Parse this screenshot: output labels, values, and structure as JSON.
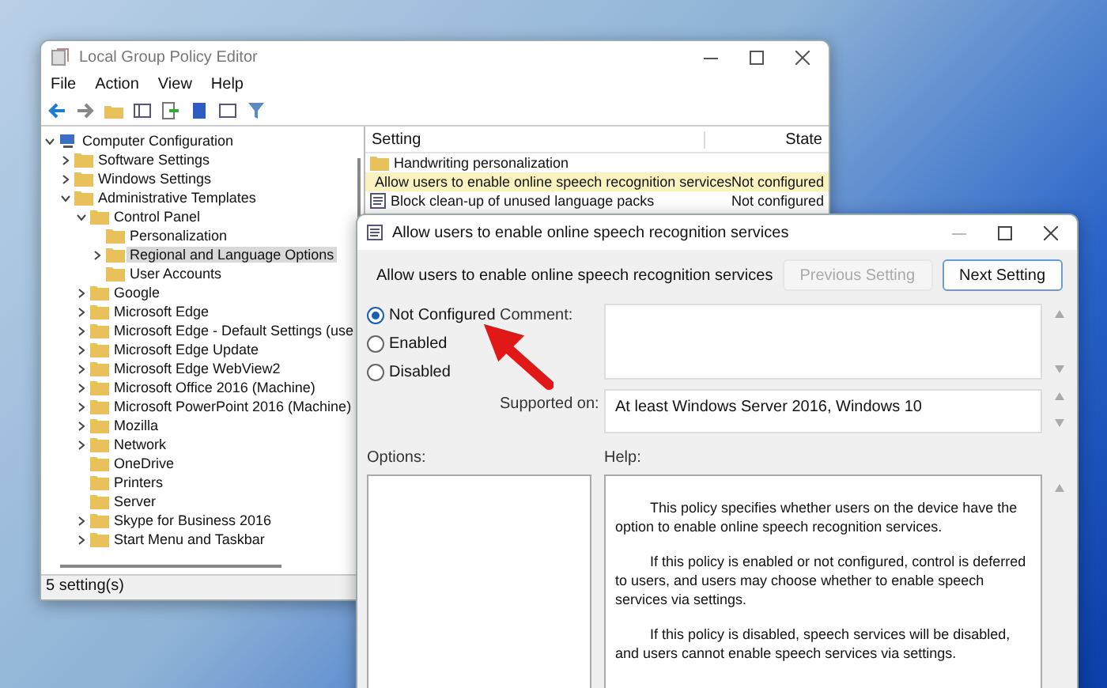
{
  "editor": {
    "title": "Local Group Policy Editor",
    "menu": [
      "File",
      "Action",
      "View",
      "Help"
    ],
    "tree": [
      {
        "label": "Computer Configuration",
        "kind": "computer",
        "expanded": true,
        "selected": false,
        "children": [
          {
            "label": "Software Settings",
            "kind": "folder",
            "expanded": false,
            "selected": false
          },
          {
            "label": "Windows Settings",
            "kind": "folder",
            "expanded": false,
            "selected": false
          },
          {
            "label": "Administrative Templates",
            "kind": "folder",
            "expanded": true,
            "selected": false,
            "children": [
              {
                "label": "Control Panel",
                "kind": "folder",
                "expanded": true,
                "selected": false,
                "children": [
                  {
                    "label": "Personalization",
                    "kind": "folder",
                    "selected": false
                  },
                  {
                    "label": "Regional and Language Options",
                    "kind": "folder",
                    "expanded": false,
                    "selected": true
                  },
                  {
                    "label": "User Accounts",
                    "kind": "folder",
                    "selected": false
                  }
                ]
              },
              {
                "label": "Google",
                "kind": "folder",
                "expanded": false,
                "selected": false
              },
              {
                "label": "Microsoft Edge",
                "kind": "folder",
                "expanded": false,
                "selected": false
              },
              {
                "label": "Microsoft Edge - Default Settings (use",
                "kind": "folder",
                "expanded": false,
                "selected": false
              },
              {
                "label": "Microsoft Edge Update",
                "kind": "folder",
                "expanded": false,
                "selected": false
              },
              {
                "label": "Microsoft Edge WebView2",
                "kind": "folder",
                "expanded": false,
                "selected": false
              },
              {
                "label": "Microsoft Office 2016 (Machine)",
                "kind": "folder",
                "expanded": false,
                "selected": false
              },
              {
                "label": "Microsoft PowerPoint 2016 (Machine)",
                "kind": "folder",
                "expanded": false,
                "selected": false
              },
              {
                "label": "Mozilla",
                "kind": "folder",
                "expanded": false,
                "selected": false
              },
              {
                "label": "Network",
                "kind": "folder",
                "expanded": false,
                "selected": false
              },
              {
                "label": "OneDrive",
                "kind": "folder",
                "selected": false
              },
              {
                "label": "Printers",
                "kind": "folder",
                "selected": false
              },
              {
                "label": "Server",
                "kind": "folder",
                "selected": false
              },
              {
                "label": "Skype for Business 2016",
                "kind": "folder",
                "expanded": false,
                "selected": false
              },
              {
                "label": "Start Menu and Taskbar",
                "kind": "folder",
                "expanded": false,
                "selected": false
              }
            ]
          }
        ]
      }
    ],
    "list": {
      "columns": [
        "Setting",
        "State"
      ],
      "rows": [
        {
          "kind": "folder",
          "setting": "Handwriting personalization",
          "selected": false
        },
        {
          "kind": "policy",
          "setting": "Allow users to enable online speech recognition services",
          "state": "Not configured",
          "selected": true
        },
        {
          "kind": "policy",
          "setting": "Block clean-up of unused language packs",
          "state": "Not configured",
          "selected": false
        }
      ]
    },
    "status": "5 setting(s)"
  },
  "dialog": {
    "title": "Allow users to enable online speech recognition services",
    "heading": "Allow users to enable online speech recognition services",
    "buttons": [
      {
        "label": "Previous Setting",
        "disabled": true
      },
      {
        "label": "Next Setting",
        "disabled": false
      }
    ],
    "options": [
      {
        "label": "Not Configured",
        "selected": true
      },
      {
        "label": "Enabled",
        "selected": false
      },
      {
        "label": "Disabled",
        "selected": false
      }
    ],
    "comment_label": "Comment:",
    "supported_label": "Supported on:",
    "supported": "At least Windows Server 2016, Windows 10",
    "options_label": "Options:",
    "help_label": "Help:",
    "help": [
      "This policy specifies whether users on the device have the option to enable online speech recognition services.",
      "If this policy is enabled or not configured, control is deferred to users, and users may choose whether to enable speech services via settings.",
      "If this policy is disabled, speech services will be disabled, and users cannot enable speech services via settings."
    ]
  }
}
